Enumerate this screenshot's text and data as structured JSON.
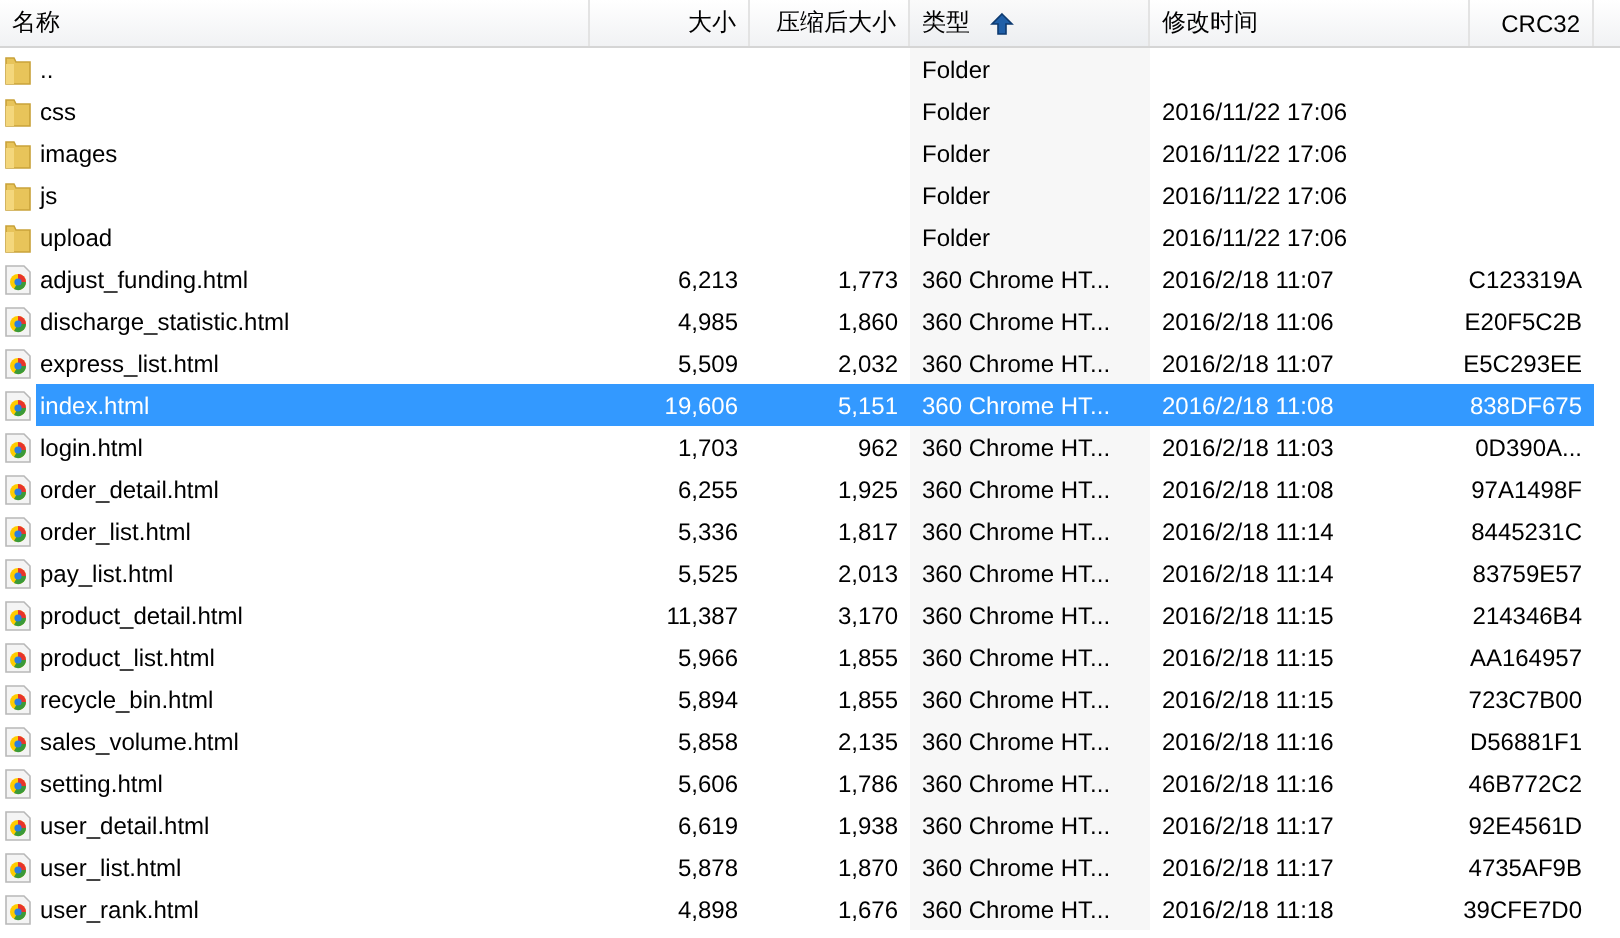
{
  "table": {
    "columns": [
      {
        "label": "名称",
        "sorted": false
      },
      {
        "label": "大小",
        "sorted": false
      },
      {
        "label": "压缩后大小",
        "sorted": false
      },
      {
        "label": "类型",
        "sorted": true
      },
      {
        "label": "修改时间",
        "sorted": false
      },
      {
        "label": "CRC32",
        "sorted": false
      }
    ],
    "rows": [
      {
        "kind": "folder",
        "name": "..",
        "type": "Folder",
        "selected": false
      },
      {
        "kind": "folder",
        "name": "css",
        "type": "Folder",
        "modified": "2016/11/22 17:06",
        "selected": false
      },
      {
        "kind": "folder",
        "name": "images",
        "type": "Folder",
        "modified": "2016/11/22 17:06",
        "selected": false
      },
      {
        "kind": "folder",
        "name": "js",
        "type": "Folder",
        "modified": "2016/11/22 17:06",
        "selected": false
      },
      {
        "kind": "folder",
        "name": "upload",
        "type": "Folder",
        "modified": "2016/11/22 17:06",
        "selected": false
      },
      {
        "kind": "file",
        "name": "adjust_funding.html",
        "size": "6,213",
        "packed": "1,773",
        "type": "360 Chrome HT...",
        "modified": "2016/2/18 11:07",
        "crc": "C123319A",
        "selected": false
      },
      {
        "kind": "file",
        "name": "discharge_statistic.html",
        "size": "4,985",
        "packed": "1,860",
        "type": "360 Chrome HT...",
        "modified": "2016/2/18 11:06",
        "crc": "E20F5C2B",
        "selected": false
      },
      {
        "kind": "file",
        "name": "express_list.html",
        "size": "5,509",
        "packed": "2,032",
        "type": "360 Chrome HT...",
        "modified": "2016/2/18 11:07",
        "crc": "E5C293EE",
        "selected": false
      },
      {
        "kind": "file",
        "name": "index.html",
        "size": "19,606",
        "packed": "5,151",
        "type": "360 Chrome HT...",
        "modified": "2016/2/18 11:08",
        "crc": "838DF675",
        "selected": true
      },
      {
        "kind": "file",
        "name": "login.html",
        "size": "1,703",
        "packed": "962",
        "type": "360 Chrome HT...",
        "modified": "2016/2/18 11:03",
        "crc": "0D390A...",
        "selected": false
      },
      {
        "kind": "file",
        "name": "order_detail.html",
        "size": "6,255",
        "packed": "1,925",
        "type": "360 Chrome HT...",
        "modified": "2016/2/18 11:08",
        "crc": "97A1498F",
        "selected": false
      },
      {
        "kind": "file",
        "name": "order_list.html",
        "size": "5,336",
        "packed": "1,817",
        "type": "360 Chrome HT...",
        "modified": "2016/2/18 11:14",
        "crc": "8445231C",
        "selected": false
      },
      {
        "kind": "file",
        "name": "pay_list.html",
        "size": "5,525",
        "packed": "2,013",
        "type": "360 Chrome HT...",
        "modified": "2016/2/18 11:14",
        "crc": "83759E57",
        "selected": false
      },
      {
        "kind": "file",
        "name": "product_detail.html",
        "size": "11,387",
        "packed": "3,170",
        "type": "360 Chrome HT...",
        "modified": "2016/2/18 11:15",
        "crc": "214346B4",
        "selected": false
      },
      {
        "kind": "file",
        "name": "product_list.html",
        "size": "5,966",
        "packed": "1,855",
        "type": "360 Chrome HT...",
        "modified": "2016/2/18 11:15",
        "crc": "AA164957",
        "selected": false
      },
      {
        "kind": "file",
        "name": "recycle_bin.html",
        "size": "5,894",
        "packed": "1,855",
        "type": "360 Chrome HT...",
        "modified": "2016/2/18 11:15",
        "crc": "723C7B00",
        "selected": false
      },
      {
        "kind": "file",
        "name": "sales_volume.html",
        "size": "5,858",
        "packed": "2,135",
        "type": "360 Chrome HT...",
        "modified": "2016/2/18 11:16",
        "crc": "D56881F1",
        "selected": false
      },
      {
        "kind": "file",
        "name": "setting.html",
        "size": "5,606",
        "packed": "1,786",
        "type": "360 Chrome HT...",
        "modified": "2016/2/18 11:16",
        "crc": "46B772C2",
        "selected": false
      },
      {
        "kind": "file",
        "name": "user_detail.html",
        "size": "6,619",
        "packed": "1,938",
        "type": "360 Chrome HT...",
        "modified": "2016/2/18 11:17",
        "crc": "92E4561D",
        "selected": false
      },
      {
        "kind": "file",
        "name": "user_list.html",
        "size": "5,878",
        "packed": "1,870",
        "type": "360 Chrome HT...",
        "modified": "2016/2/18 11:17",
        "crc": "4735AF9B",
        "selected": false
      },
      {
        "kind": "file",
        "name": "user_rank.html",
        "size": "4,898",
        "packed": "1,676",
        "type": "360 Chrome HT...",
        "modified": "2016/2/18 11:18",
        "crc": "39CFE7D0",
        "selected": false
      }
    ]
  }
}
